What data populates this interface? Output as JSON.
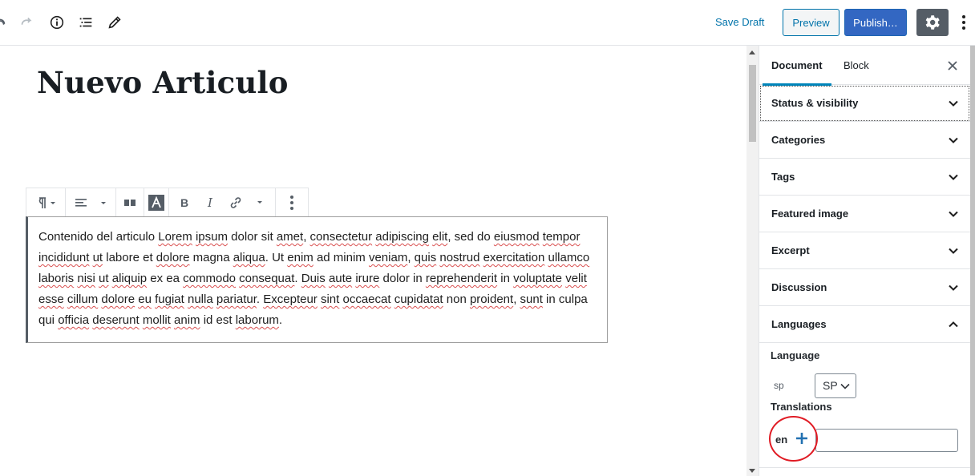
{
  "topbar": {
    "undo_icon": "undo-icon",
    "redo_icon": "redo-icon",
    "info_icon": "info-icon",
    "outline_icon": "list-icon",
    "tools_icon": "pencil-icon",
    "save_draft_label": "Save Draft",
    "preview_label": "Preview",
    "publish_label": "Publish…",
    "settings_icon": "gear-icon",
    "more_icon": "more-vertical-icon"
  },
  "editor": {
    "title": "Nuevo Articulo",
    "paragraph_words": [
      {
        "t": "Contenido del articulo "
      },
      {
        "t": "Lorem",
        "s": true
      },
      {
        "t": " "
      },
      {
        "t": "ipsum",
        "s": true
      },
      {
        "t": " dolor sit "
      },
      {
        "t": "amet",
        "s": true
      },
      {
        "t": ", "
      },
      {
        "t": "consectetur",
        "s": true
      },
      {
        "t": " "
      },
      {
        "t": "adipiscing",
        "s": true
      },
      {
        "t": " "
      },
      {
        "t": "elit",
        "s": true
      },
      {
        "t": ", sed do "
      },
      {
        "t": "eiusmod",
        "s": true
      },
      {
        "t": " "
      },
      {
        "t": "tempor",
        "s": true
      },
      {
        "t": " "
      },
      {
        "t": "incididunt",
        "s": true
      },
      {
        "t": " "
      },
      {
        "t": "ut",
        "s": true
      },
      {
        "t": " labore et "
      },
      {
        "t": "dolore",
        "s": true
      },
      {
        "t": " magna "
      },
      {
        "t": "aliqua",
        "s": true
      },
      {
        "t": ". Ut "
      },
      {
        "t": "enim",
        "s": true
      },
      {
        "t": " ad minim "
      },
      {
        "t": "veniam",
        "s": true
      },
      {
        "t": ", "
      },
      {
        "t": "quis",
        "s": true
      },
      {
        "t": " "
      },
      {
        "t": "nostrud",
        "s": true
      },
      {
        "t": " "
      },
      {
        "t": "exercitation",
        "s": true
      },
      {
        "t": " "
      },
      {
        "t": "ullamco",
        "s": true
      },
      {
        "t": " "
      },
      {
        "t": "laboris",
        "s": true
      },
      {
        "t": " "
      },
      {
        "t": "nisi",
        "s": true
      },
      {
        "t": " "
      },
      {
        "t": "ut",
        "s": true
      },
      {
        "t": " "
      },
      {
        "t": "aliquip",
        "s": true
      },
      {
        "t": " ex ea "
      },
      {
        "t": "commodo",
        "s": true
      },
      {
        "t": " "
      },
      {
        "t": "consequat",
        "s": true
      },
      {
        "t": ". "
      },
      {
        "t": "Duis",
        "s": true
      },
      {
        "t": " "
      },
      {
        "t": "aute",
        "s": true
      },
      {
        "t": " "
      },
      {
        "t": "irure",
        "s": true
      },
      {
        "t": " dolor in "
      },
      {
        "t": "reprehenderit",
        "s": true
      },
      {
        "t": " in "
      },
      {
        "t": "voluptate",
        "s": true
      },
      {
        "t": " "
      },
      {
        "t": "velit",
        "s": true
      },
      {
        "t": " "
      },
      {
        "t": "esse",
        "s": true
      },
      {
        "t": " "
      },
      {
        "t": "cillum",
        "s": true
      },
      {
        "t": " "
      },
      {
        "t": "dolore",
        "s": true
      },
      {
        "t": " "
      },
      {
        "t": "eu",
        "s": true
      },
      {
        "t": " "
      },
      {
        "t": "fugiat",
        "s": true
      },
      {
        "t": " "
      },
      {
        "t": "nulla",
        "s": true
      },
      {
        "t": " "
      },
      {
        "t": "pariatur",
        "s": true
      },
      {
        "t": ". "
      },
      {
        "t": "Excepteur",
        "s": true
      },
      {
        "t": " "
      },
      {
        "t": "sint",
        "s": true
      },
      {
        "t": " "
      },
      {
        "t": "occaecat",
        "s": true
      },
      {
        "t": " "
      },
      {
        "t": "cupidatat",
        "s": true
      },
      {
        "t": " non "
      },
      {
        "t": "proident",
        "s": true
      },
      {
        "t": ", "
      },
      {
        "t": "sunt",
        "s": true
      },
      {
        "t": " in culpa qui "
      },
      {
        "t": "officia",
        "s": true
      },
      {
        "t": " "
      },
      {
        "t": "deserunt",
        "s": true
      },
      {
        "t": " "
      },
      {
        "t": "mollit",
        "s": true
      },
      {
        "t": " "
      },
      {
        "t": "anim",
        "s": true
      },
      {
        "t": " id est "
      },
      {
        "t": "laborum",
        "s": true
      },
      {
        "t": "."
      }
    ]
  },
  "block_toolbar": {
    "icons": [
      "paragraph-icon",
      "align-left-icon",
      "columns-icon",
      "text-color-icon",
      "bold-icon",
      "italic-icon",
      "link-icon",
      "more-vertical-icon"
    ]
  },
  "sidebar": {
    "tabs": [
      {
        "label": "Document",
        "active": true
      },
      {
        "label": "Block",
        "active": false
      }
    ],
    "close_icon": "close-icon",
    "panels": [
      {
        "label": "Status & visibility"
      },
      {
        "label": "Categories"
      },
      {
        "label": "Tags"
      },
      {
        "label": "Featured image"
      },
      {
        "label": "Excerpt"
      },
      {
        "label": "Discussion"
      }
    ],
    "languages": {
      "title": "Languages",
      "language_label": "Language",
      "language_code": "sp",
      "language_selected": "SP",
      "translations_label": "Translations",
      "translation_code": "en",
      "translation_value": "",
      "add_icon": "plus-icon"
    }
  },
  "colors": {
    "accent": "#0073aa",
    "publish": "#3367c2",
    "settings_bg": "#555d66",
    "highlight_circle": "#e01b24",
    "spellcheck": "#d94f4f"
  }
}
